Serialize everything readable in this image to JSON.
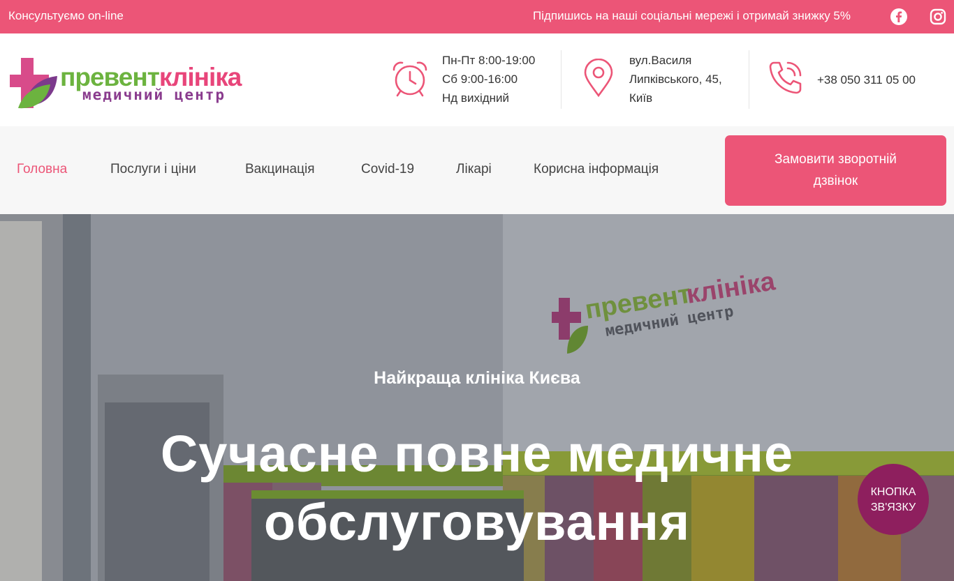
{
  "topbar": {
    "consult": "Консультуємо on-line",
    "promo": "Підпишись на наші соціальні мережі і отримай знижку 5%",
    "social": [
      {
        "icon": "facebook-icon"
      },
      {
        "icon": "instagram-icon"
      }
    ]
  },
  "logo": {
    "word_green": "превент",
    "word_pink": "клініка",
    "subtitle": "медичний центр"
  },
  "header": {
    "hours": {
      "icon": "alarm-clock-icon",
      "lines": [
        "Пн-Пт 8:00-19:00",
        "Сб 9:00-16:00",
        "Нд вихідний"
      ]
    },
    "address": {
      "icon": "location-pin-icon",
      "lines": [
        "вул.Василя",
        "Липківського, 45,",
        "Київ"
      ]
    },
    "phone": {
      "icon": "phone-icon",
      "value": "+38 050 311 05 00"
    }
  },
  "nav": {
    "items": [
      {
        "label": "Головна",
        "active": true
      },
      {
        "label": "Послуги і ціни"
      },
      {
        "label": "Вакцинація"
      },
      {
        "label": "Covid-19"
      },
      {
        "label": "Лікарі"
      },
      {
        "label": "Корисна інформація"
      }
    ],
    "cta": "Замовити зворотній дзвінок"
  },
  "hero": {
    "subtitle": "Найкраща клініка Києва",
    "title_line1": "Сучасне повне медичне",
    "title_line2": "обслуговування"
  },
  "contact_bubble": {
    "line1": "КНОПКА",
    "line2": "ЗВ'ЯЗКУ"
  },
  "colors": {
    "brand_pink": "#ec5577",
    "brand_green": "#6cb33f",
    "brand_purple": "#8a3c8e",
    "bubble": "#8e1f5e"
  }
}
